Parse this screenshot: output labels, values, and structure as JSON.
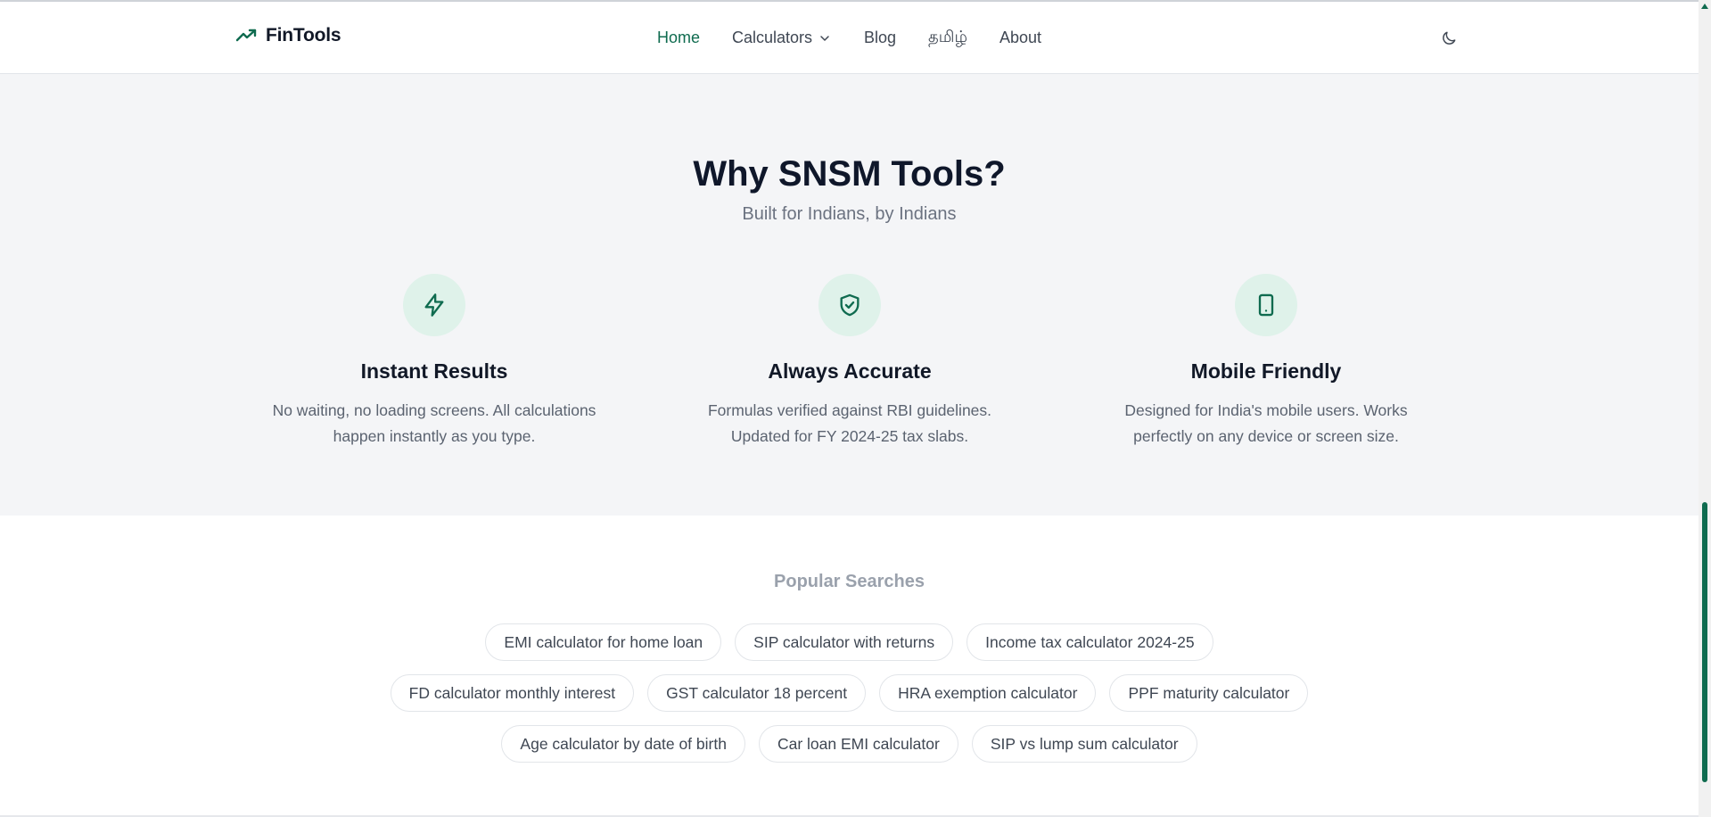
{
  "header": {
    "brand": "FinTools",
    "nav": [
      {
        "label": "Home",
        "active": true
      },
      {
        "label": "Calculators",
        "has_dropdown": true
      },
      {
        "label": "Blog"
      },
      {
        "label": "தமிழ்"
      },
      {
        "label": "About"
      }
    ],
    "theme_toggle_icon": "moon-icon"
  },
  "features": {
    "title": "Why SNSM Tools?",
    "subtitle": "Built for Indians, by Indians",
    "items": [
      {
        "icon": "lightning-icon",
        "title": "Instant Results",
        "desc_line1": "No waiting, no loading screens. All calculations",
        "desc_line2": "happen instantly as you type."
      },
      {
        "icon": "shield-check-icon",
        "title": "Always Accurate",
        "desc_line1": "Formulas verified against RBI guidelines.",
        "desc_line2": "Updated for FY 2024-25 tax slabs."
      },
      {
        "icon": "smartphone-icon",
        "title": "Mobile Friendly",
        "desc_line1": "Designed for India's mobile users. Works",
        "desc_line2": "perfectly on any device or screen size."
      }
    ]
  },
  "popular": {
    "title": "Popular Searches",
    "rows": [
      [
        "EMI calculator for home loan",
        "SIP calculator with returns",
        "Income tax calculator 2024-25"
      ],
      [
        "FD calculator monthly interest",
        "GST calculator 18 percent",
        "HRA exemption calculator",
        "PPF maturity calculator"
      ],
      [
        "Age calculator by date of birth",
        "Car loan EMI calculator",
        "SIP vs lump sum calculator"
      ]
    ]
  },
  "colors": {
    "accent": "#0f6b4f",
    "icon_bg": "#dff2ea",
    "section_bg": "#f4f5f7"
  }
}
